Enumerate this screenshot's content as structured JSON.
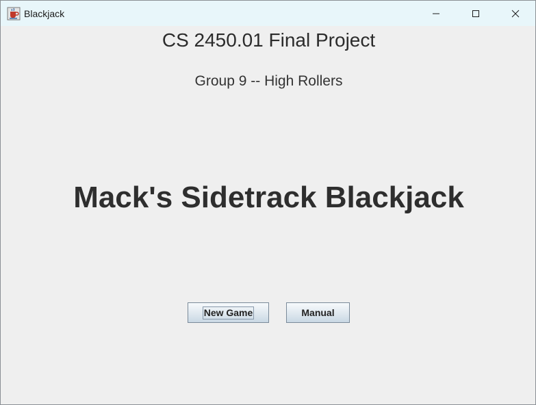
{
  "window": {
    "title": "Blackjack",
    "app_icon": "java-cup-icon",
    "controls": {
      "minimize_icon": "minimize-icon",
      "maximize_icon": "maximize-icon",
      "close_icon": "close-icon"
    }
  },
  "main": {
    "project_title": "CS 2450.01 Final Project",
    "group_title": "Group 9 -- High Rollers",
    "game_title": "Mack's Sidetrack Blackjack"
  },
  "buttons": {
    "new_game_label": "New Game",
    "manual_label": "Manual"
  }
}
